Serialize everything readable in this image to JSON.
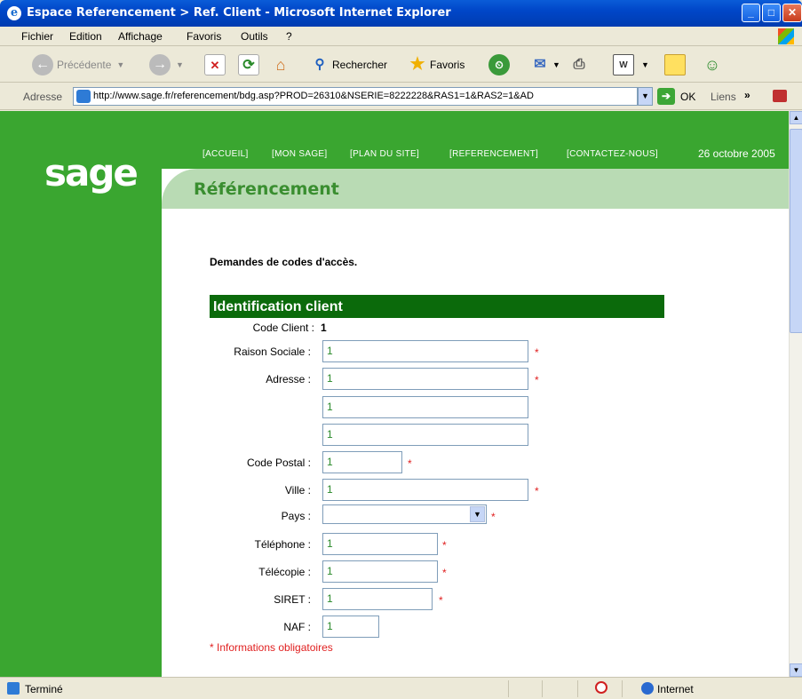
{
  "window": {
    "title": "Espace Referencement > Ref. Client - Microsoft Internet Explorer"
  },
  "menu": [
    "Fichier",
    "Edition",
    "Affichage",
    "Favoris",
    "Outils",
    "?"
  ],
  "toolbar": {
    "back_label": "Précédente",
    "search_label": "Rechercher",
    "favorites_label": "Favoris"
  },
  "address": {
    "label": "Adresse",
    "url": "http://www.sage.fr/referencement/bdg.asp?PROD=26310&NSERIE=8222228&RAS1=1&RAS2=1&AD",
    "go_label": "OK",
    "links_label": "Liens"
  },
  "site": {
    "logo": "sage",
    "nav": [
      "[ACCUEIL]",
      "[MON SAGE]",
      "[PLAN DU SITE]",
      "[REFERENCEMENT]",
      "[CONTACTEZ-NOUS]"
    ],
    "date": "26 octobre 2005",
    "heading": "Référencement"
  },
  "form": {
    "subtitle": "Demandes de codes d'accès.",
    "section_title": "Identification client",
    "code_client_label": "Code Client :",
    "code_client_value": "1",
    "raison_sociale_label": "Raison Sociale :",
    "raison_sociale_value": "1",
    "adresse_label": "Adresse :",
    "adresse1_value": "1",
    "adresse2_value": "1",
    "adresse3_value": "1",
    "code_postal_label": "Code Postal :",
    "code_postal_value": "1",
    "ville_label": "Ville :",
    "ville_value": "1",
    "pays_label": "Pays :",
    "pays_value": "",
    "telephone_label": "Téléphone :",
    "telephone_value": "1",
    "telecopie_label": "Télécopie :",
    "telecopie_value": "1",
    "siret_label": "SIRET :",
    "siret_value": "1",
    "naf_label": "NAF :",
    "naf_value": "1",
    "required_marker": "*",
    "required_note": "* Informations obligatoires"
  },
  "status": {
    "text": "Terminé",
    "zone": "Internet"
  },
  "colors": {
    "site_green": "#3aa630",
    "dark_green": "#0b6a0b",
    "required_red": "#e02020",
    "xp_blue": "#0046c8"
  }
}
